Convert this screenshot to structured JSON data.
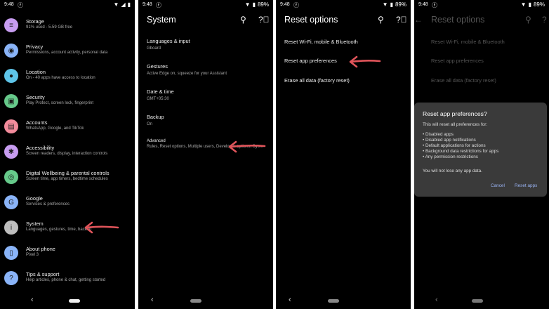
{
  "status": {
    "time": "9:48",
    "battery": "89%"
  },
  "panel1": {
    "items": [
      {
        "title": "Storage",
        "sub": "91% used - 5.59 GB free",
        "icon": "storage-icon",
        "color": "#c79cf0",
        "glyph": "≡"
      },
      {
        "title": "Privacy",
        "sub": "Permissions, account activity, personal data",
        "icon": "privacy-icon",
        "color": "#8ab4f8",
        "glyph": "◉"
      },
      {
        "title": "Location",
        "sub": "On - 40 apps have access to location",
        "icon": "location-icon",
        "color": "#5ec4e8",
        "glyph": "●"
      },
      {
        "title": "Security",
        "sub": "Play Protect, screen lock, fingerprint",
        "icon": "security-icon",
        "color": "#66c98a",
        "glyph": "▣"
      },
      {
        "title": "Accounts",
        "sub": "WhatsApp, Google, and TikTok",
        "icon": "accounts-icon",
        "color": "#f28b9b",
        "glyph": "▤"
      },
      {
        "title": "Accessibility",
        "sub": "Screen readers, display, interaction controls",
        "icon": "accessibility-icon",
        "color": "#c79cf0",
        "glyph": "✱"
      },
      {
        "title": "Digital Wellbeing & parental controls",
        "sub": "Screen time, app timers, bedtime schedules",
        "icon": "wellbeing-icon",
        "color": "#66c98a",
        "glyph": "◎"
      },
      {
        "title": "Google",
        "sub": "Services & preferences",
        "icon": "google-icon",
        "color": "#8ab4f8",
        "glyph": "G"
      },
      {
        "title": "System",
        "sub": "Languages, gestures, time, backup",
        "icon": "system-icon",
        "color": "#bdbdbd",
        "glyph": "i"
      },
      {
        "title": "About phone",
        "sub": "Pixel 3",
        "icon": "about-phone-icon",
        "color": "#8ab4f8",
        "glyph": "▯"
      },
      {
        "title": "Tips & support",
        "sub": "Help articles, phone & chat, getting started",
        "icon": "tips-icon",
        "color": "#8ab4f8",
        "glyph": "?"
      }
    ]
  },
  "panel2": {
    "title": "System",
    "items": [
      {
        "title": "Languages & input",
        "sub": "Gboard"
      },
      {
        "title": "Gestures",
        "sub": "Active Edge on, squeeze for your Assistant"
      },
      {
        "title": "Date & time",
        "sub": "GMT+05:30"
      },
      {
        "title": "Backup",
        "sub": "On"
      }
    ],
    "advanced": {
      "title": "Advanced",
      "sub": "Rules, Reset options, Multiple users, Developer options, Sys..."
    }
  },
  "panel3": {
    "title": "Reset options",
    "options": [
      "Reset Wi-Fi, mobile & Bluetooth",
      "Reset app preferences",
      "Erase all data (factory reset)"
    ]
  },
  "panel4": {
    "title": "Reset options",
    "options": [
      "Reset Wi-Fi, mobile & Bluetooth",
      "Reset app preferences",
      "Erase all data (factory reset)"
    ],
    "dialog": {
      "title": "Reset app preferences?",
      "intro": "This will reset all preferences for:",
      "bullets": [
        "• Disabled apps",
        "• Disabled app notifications",
        "• Default applications for actions",
        "• Background data restrictions for apps",
        "• Any permission restrictions"
      ],
      "note": "You will not lose any app data.",
      "cancel": "Cancel",
      "confirm": "Reset apps"
    }
  },
  "colors": {
    "arrow": "#e0545a",
    "accent": "#9ab4f4"
  }
}
